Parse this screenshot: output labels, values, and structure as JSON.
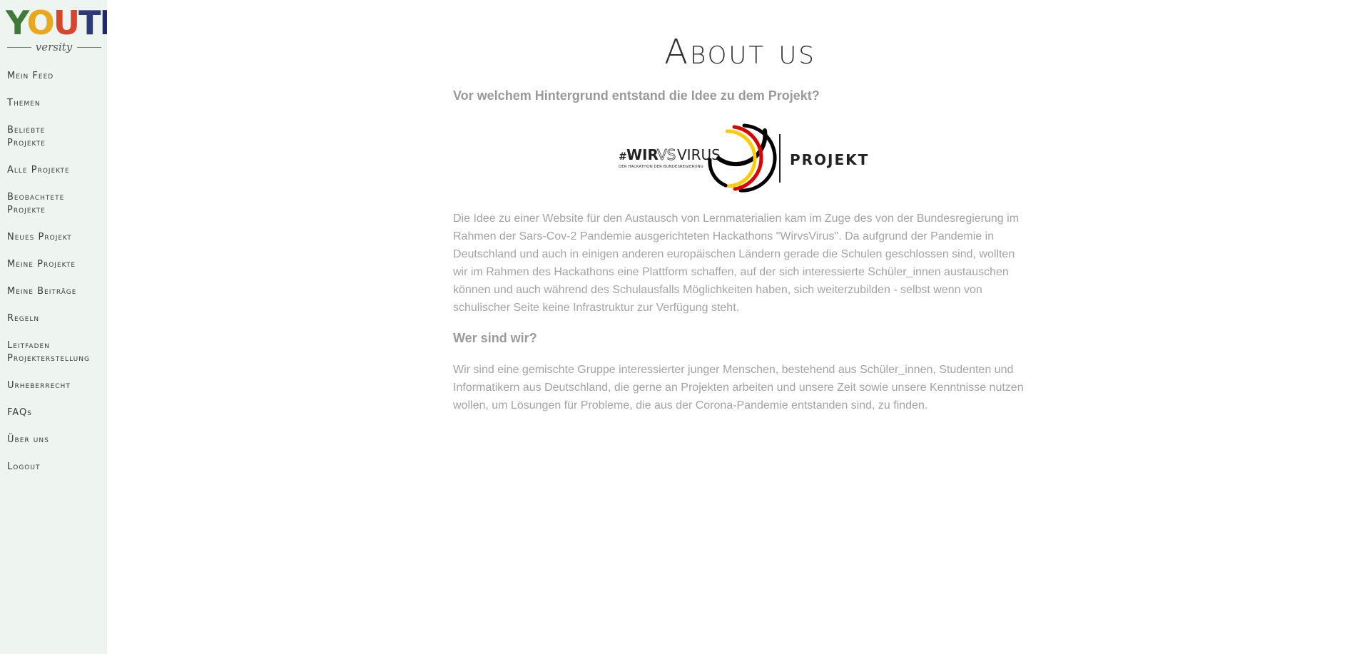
{
  "logo": {
    "word_letters": [
      "Y",
      "O",
      "U",
      "T",
      "H"
    ],
    "word_colors": [
      "#3f7a3a",
      "#e8a71d",
      "#d9452c",
      "#2c3a7a",
      "#1f2b6d"
    ],
    "sub": "versity"
  },
  "sidebar": {
    "items": [
      {
        "label": "Mein Feed"
      },
      {
        "label": "Themen"
      },
      {
        "label": "Beliebte Projekte"
      },
      {
        "label": "Alle Projekte"
      },
      {
        "label": "Beobachtete Projekte"
      },
      {
        "label": "Neues Projekt"
      },
      {
        "label": "Meine Projekte"
      },
      {
        "label": "Meine Beiträge"
      },
      {
        "label": "Regeln"
      },
      {
        "label": "Leitfaden Projekterstellung"
      },
      {
        "label": "Urheberrecht"
      },
      {
        "label": "FAQs"
      },
      {
        "label": "Über uns"
      },
      {
        "label": "Logout"
      }
    ]
  },
  "main": {
    "title": "About us",
    "section1_heading": "Vor welchem Hintergrund entstand die Idee zu dem Projekt?",
    "banner": {
      "hash": "#",
      "wir": "WIR",
      "vs": "VS",
      "virus": "VIRUS",
      "subline": "DER HACKATHON DER BUNDESREGIERUNG",
      "projekt": "PROJEKT"
    },
    "section1_text": "Die Idee zu einer Website für den Austausch von Lernmaterialien kam im Zuge des von der Bundesregierung im Rahmen der Sars-Cov-2 Pandemie ausgerichteten Hackathons \"WirvsVirus\". Da aufgrund der Pandemie in Deutschland und auch in einigen anderen europäischen Ländern gerade die Schulen geschlossen sind, wollten wir im Rahmen des Hackathons eine Plattform schaffen, auf der sich interessierte Schüler_innen austauschen können und auch während des Schulausfalls Möglichkeiten haben, sich weiterzubilden - selbst wenn von schulischer Seite keine Infrastruktur zur Verfügung steht.",
    "section2_heading": "Wer sind wir?",
    "section2_text": "Wir sind eine gemischte Gruppe interessierter junger Menschen, bestehend aus Schüler_innen, Studenten und Informatikern aus Deutschland, die gerne an Projekten arbeiten und unsere Zeit sowie unsere Kenntnisse nutzen wollen, um Lösungen für Probleme, die aus der Corona-Pandemie entstanden sind, zu finden."
  },
  "colors": {
    "sidebar_bg": "#eef4ef",
    "german_black": "#000000",
    "german_red": "#dd0000",
    "german_gold": "#ffcc00"
  }
}
